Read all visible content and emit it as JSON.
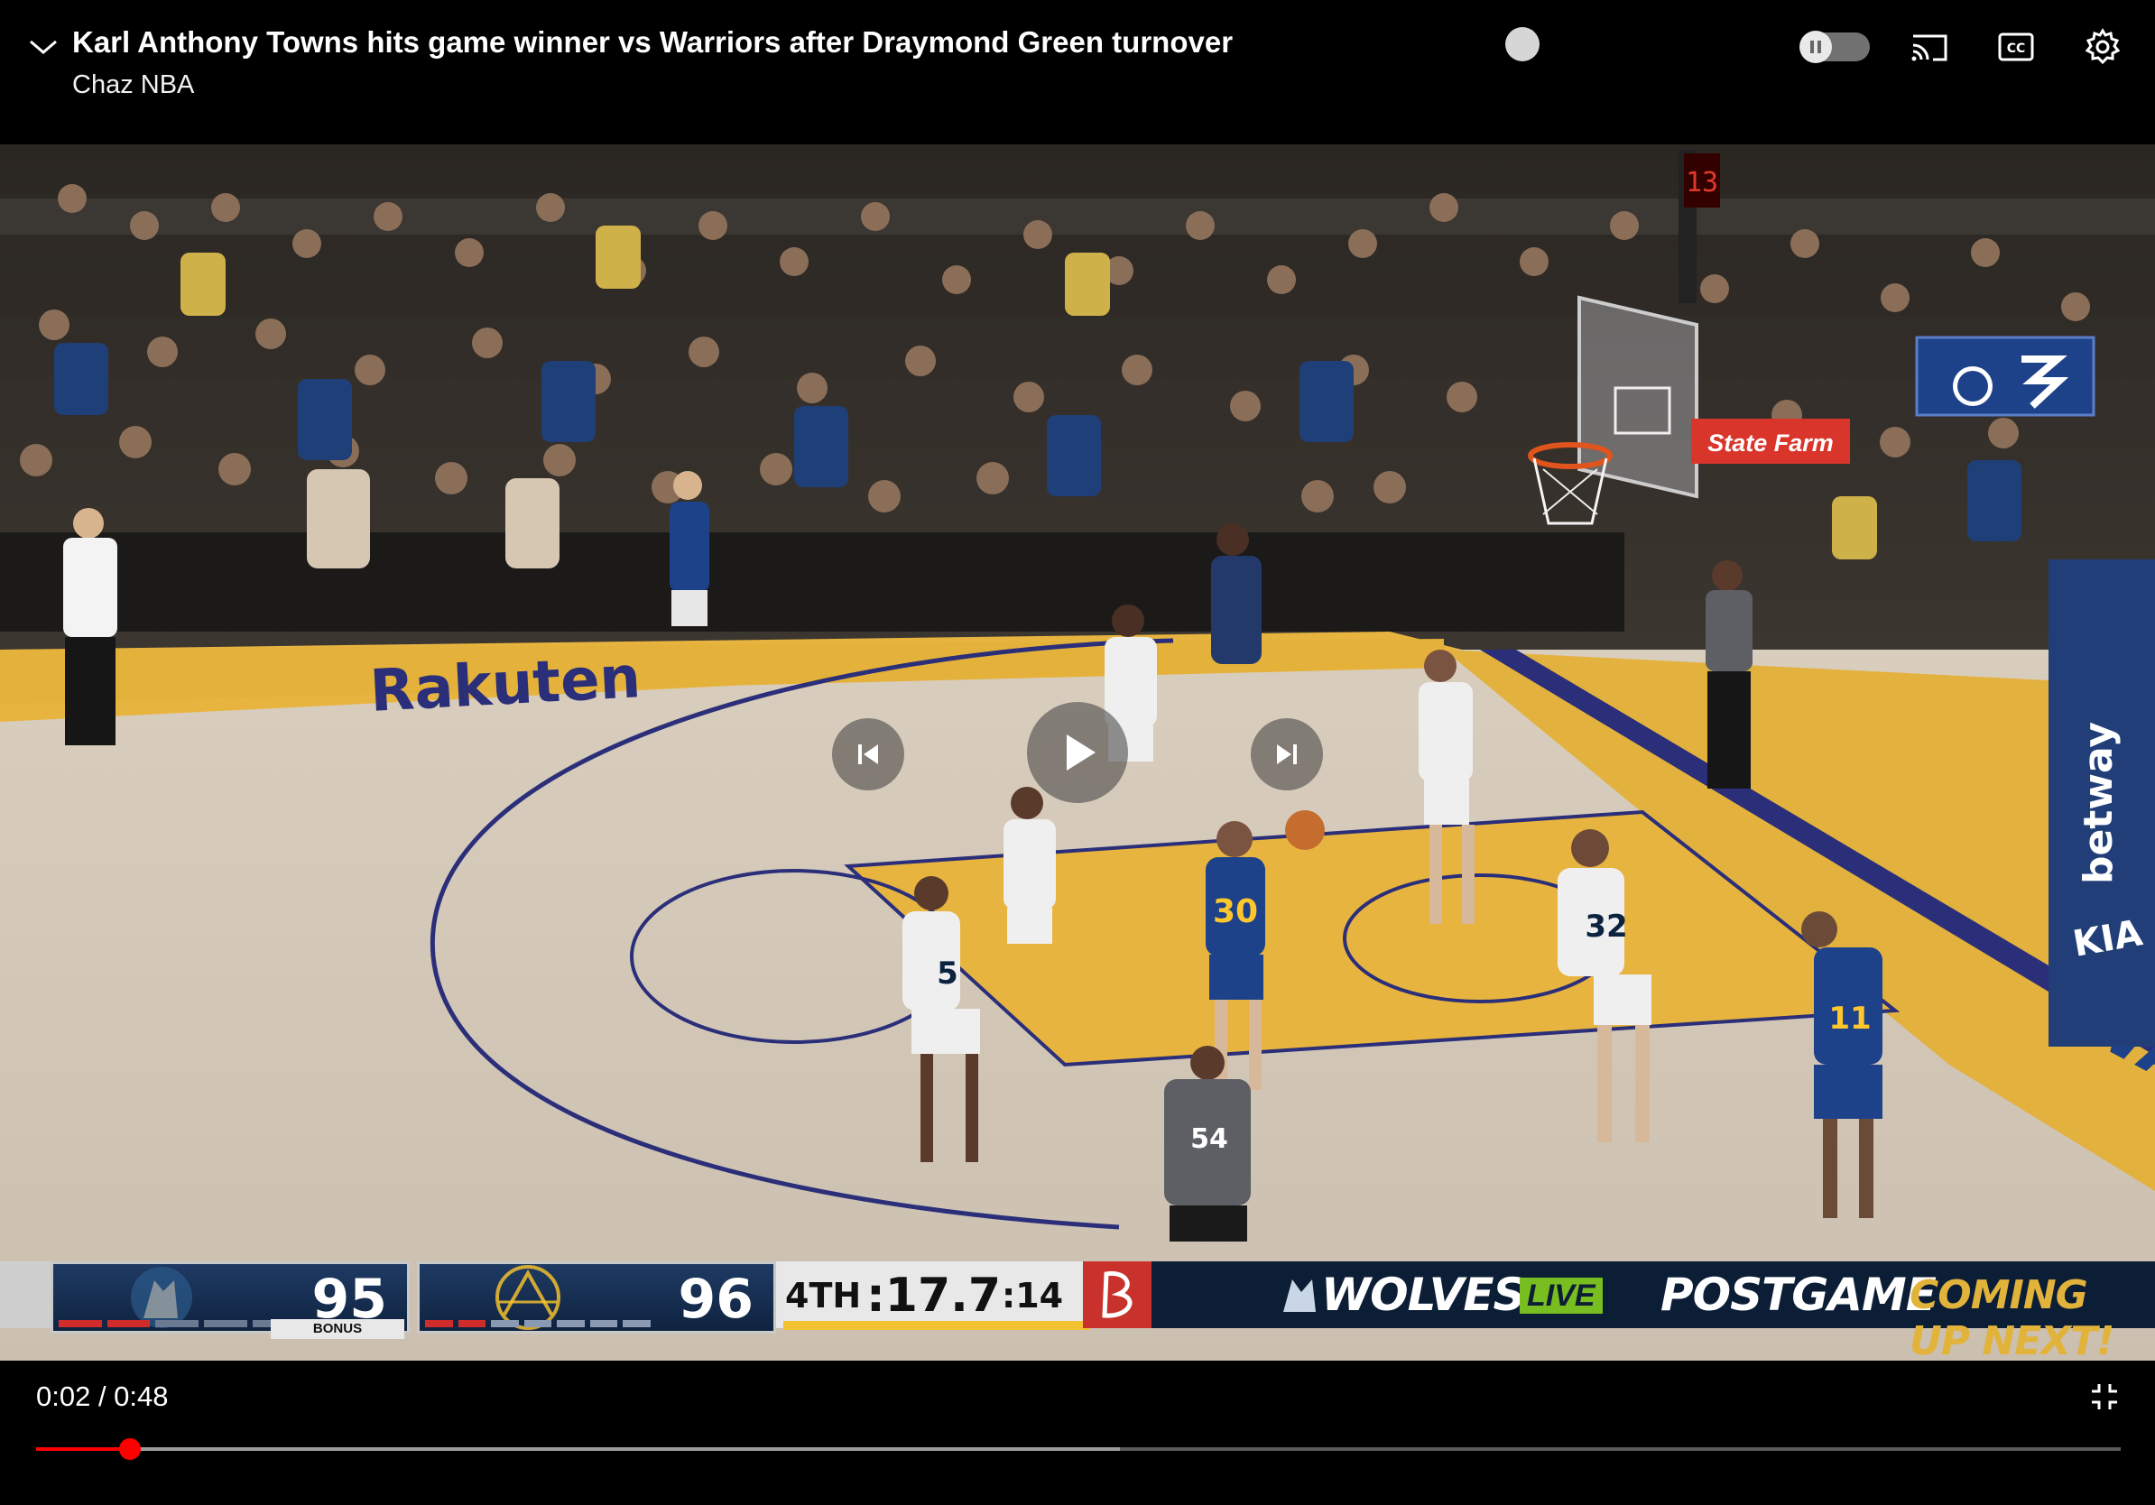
{
  "header": {
    "title": "Karl Anthony Towns hits game winner vs Warriors after Draymond Green turnover",
    "channel": "Chaz NBA"
  },
  "icons": {
    "collapse": "chevron-down-icon",
    "autoplay": "autoplay-toggle",
    "cast": "cast-icon",
    "captions": "cc-icon",
    "settings": "gear-icon",
    "previous": "skip-previous-icon",
    "play": "play-icon",
    "next": "skip-next-icon",
    "exit_fullscreen": "exit-fullscreen-icon"
  },
  "scoreboard": {
    "away_score": "95",
    "away_bonus": "BONUS",
    "home_score": "96",
    "period": "4TH",
    "game_clock": ":17.7",
    "shot_clock": ":14",
    "promo_brand": "WOLVES",
    "promo_live": "LIVE",
    "promo_show": "POSTGAME",
    "promo_next": "COMING UP NEXT!"
  },
  "scene_text": {
    "courtside_sponsor": "Rakuten",
    "ad_statefarm": "State Farm",
    "ad_betway": "betway",
    "ad_kia": "KIA",
    "player_30": "30",
    "player_5": "5",
    "player_32": "32",
    "player_11": "11",
    "ref_54": "54"
  },
  "playback": {
    "current_time": "0:02",
    "duration": "0:48",
    "time_display": "0:02 / 0:48",
    "played_fraction": 0.045,
    "buffered_fraction": 0.52
  },
  "colors": {
    "progress_played": "#ff0000",
    "wolves_navy": "#0c2340",
    "warriors_blue": "#1d428a",
    "warriors_gold": "#ffc72c",
    "court_paint": "#e7b43f",
    "live_green": "#78be20",
    "promo_gold": "#e2b33b"
  }
}
